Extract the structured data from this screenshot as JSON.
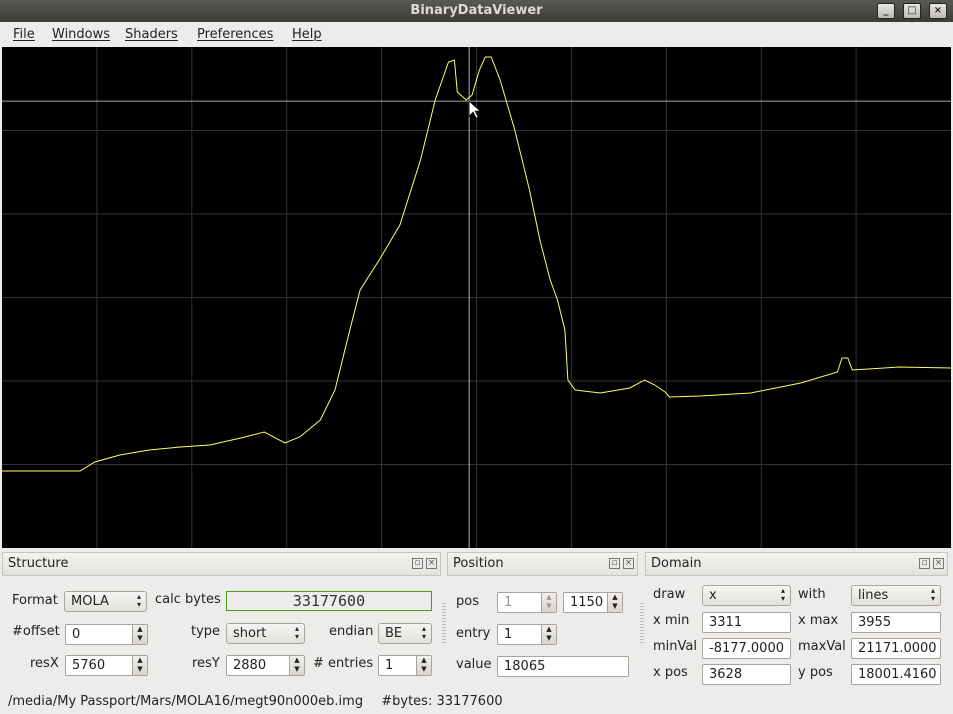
{
  "window": {
    "title": "BinaryDataViewer",
    "buttons": [
      "_",
      "□",
      "×"
    ]
  },
  "menu": [
    "File",
    "Windows",
    "Shaders",
    "Preferences",
    "Help"
  ],
  "structure": {
    "title": "Structure",
    "format_label": "Format",
    "format": "MOLA",
    "calc_bytes_label": "calc bytes",
    "calc_bytes": "33177600",
    "offset_label": "#offset",
    "offset": "0",
    "type_label": "type",
    "type": "short",
    "endian_label": "endian",
    "endian": "BE",
    "resx_label": "resX",
    "resx": "5760",
    "resy_label": "resY",
    "resy": "2880",
    "entries_label": "# entries",
    "entries": "1"
  },
  "position": {
    "title": "Position",
    "pos_label": "pos",
    "pos1": "1",
    "pos2": "1150",
    "entry_label": "entry",
    "entry": "1",
    "value_label": "value",
    "value": "18065"
  },
  "domain": {
    "title": "Domain",
    "draw_label": "draw",
    "draw": "x",
    "with_label": "with",
    "with": "lines",
    "xmin_label": "x min",
    "xmin": "3311",
    "xmax_label": "x max",
    "xmax": "3955",
    "minval_label": "minVal",
    "minval": "-8177.0000",
    "maxval_label": "maxVal",
    "maxval": "21171.0000",
    "xpos_label": "x pos",
    "xpos": "3628",
    "ypos_label": "y pos",
    "ypos": "18001.4160"
  },
  "status": {
    "path": "/media/My Passport/Mars/MOLA16/megt90n000eb.img",
    "bytes": "#bytes: 33177600"
  },
  "colors": {
    "line": "#ffff66",
    "grid": "#333333",
    "crosshair": "#dddddd"
  },
  "chart_data": {
    "type": "line",
    "xlim": [
      3311,
      3955
    ],
    "ylim": [
      -8177,
      21171
    ],
    "cursor": [
      3628,
      18001.416
    ],
    "x": [
      3311,
      3364,
      3374,
      3391,
      3411,
      3432,
      3452,
      3473,
      3489,
      3503,
      3513,
      3527,
      3537,
      3547,
      3554,
      3567,
      3581,
      3595,
      3605,
      3614,
      3618,
      3620,
      3626,
      3630,
      3635,
      3639,
      3643,
      3649,
      3659,
      3669,
      3676,
      3683,
      3688,
      3693,
      3695,
      3700,
      3717,
      3737,
      3747,
      3754,
      3761,
      3764,
      3785,
      3819,
      3853,
      3878,
      3881,
      3885,
      3888,
      3920,
      3955
    ],
    "y": [
      -3666,
      -3666,
      -3139,
      -2729,
      -2436,
      -2260,
      -2143,
      -1733,
      -1382,
      -2026,
      -1675,
      -679,
      1079,
      4593,
      6937,
      8694,
      10744,
      14552,
      18067,
      20293,
      20410,
      18535,
      18067,
      18360,
      19824,
      20586,
      20586,
      19238,
      16309,
      12795,
      9866,
      7522,
      6351,
      4593,
      1664,
      1079,
      903,
      1196,
      1664,
      1372,
      961,
      669,
      727,
      903,
      1489,
      2133,
      2953,
      2953,
      2250,
      2426,
      2367
    ]
  }
}
